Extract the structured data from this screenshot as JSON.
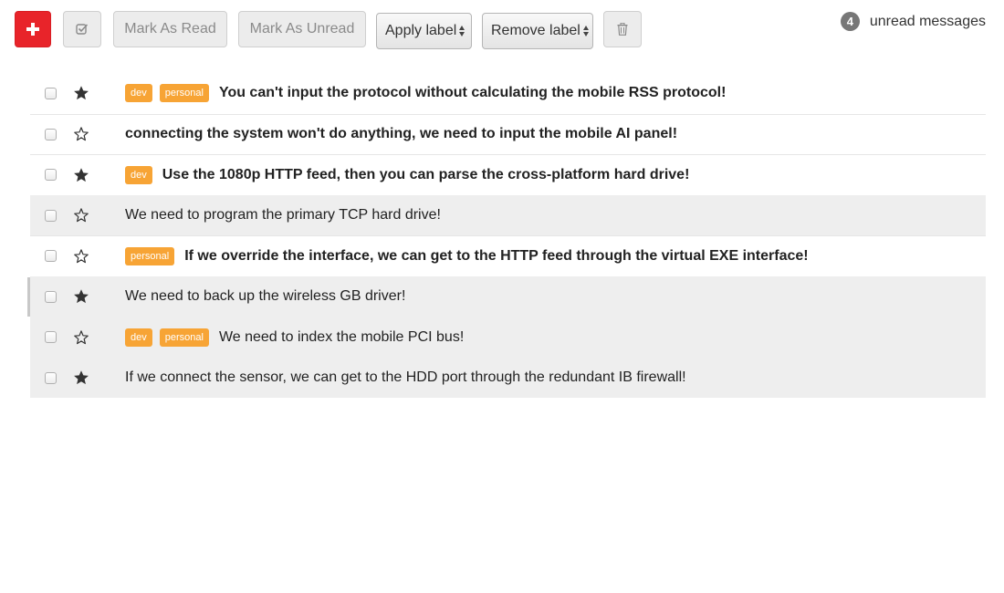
{
  "toolbar": {
    "compose_icon": "plus-icon",
    "select_icon": "checkbox-check-icon",
    "mark_read_label": "Mark As Read",
    "mark_unread_label": "Mark As Unread",
    "apply_label": "Apply label",
    "remove_label": "Remove label",
    "trash_icon": "trash-icon",
    "compose_color": "#e8242a"
  },
  "unread": {
    "count": "4",
    "text": "unread messages"
  },
  "label_color": "#f7a435",
  "messages": [
    {
      "starred": true,
      "read": false,
      "labels": [
        "dev",
        "personal"
      ],
      "subject": "You can't input the protocol without calculating the mobile RSS protocol!"
    },
    {
      "starred": false,
      "read": false,
      "labels": [],
      "subject": "connecting the system won't do anything, we need to input the mobile AI panel!"
    },
    {
      "starred": true,
      "read": false,
      "labels": [
        "dev"
      ],
      "subject": "Use the 1080p HTTP feed, then you can parse the cross-platform hard drive!"
    },
    {
      "starred": false,
      "read": true,
      "labels": [],
      "subject": "We need to program the primary TCP hard drive!"
    },
    {
      "starred": false,
      "read": false,
      "labels": [
        "personal"
      ],
      "subject": "If we override the interface, we can get to the HTTP feed through the virtual EXE interface!"
    },
    {
      "starred": true,
      "read": true,
      "labels": [],
      "subject": "We need to back up the wireless GB driver!"
    },
    {
      "starred": false,
      "read": true,
      "labels": [
        "dev",
        "personal"
      ],
      "subject": "We need to index the mobile PCI bus!"
    },
    {
      "starred": true,
      "read": true,
      "labels": [],
      "subject": "If we connect the sensor, we can get to the HDD port through the redundant IB firewall!"
    }
  ]
}
